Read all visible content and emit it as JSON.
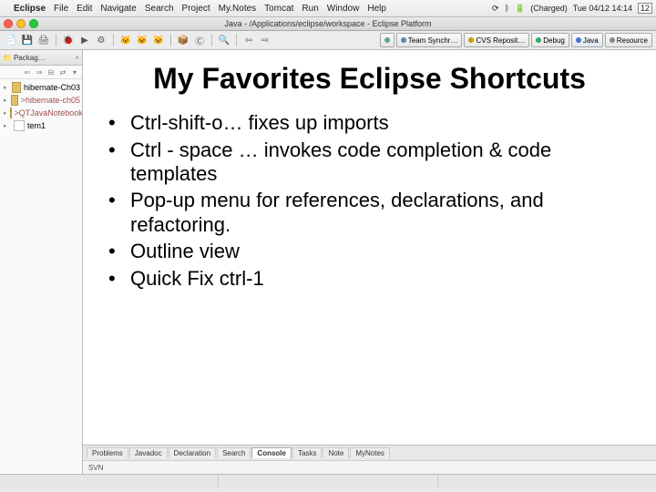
{
  "mac_menu": {
    "app_name": "Eclipse",
    "items": [
      "File",
      "Edit",
      "Navigate",
      "Search",
      "Project",
      "My.Notes",
      "Tomcat",
      "Run",
      "Window",
      "Help"
    ],
    "charge_label": "(Charged)",
    "clock": "Tue 04/12 14:14",
    "day_num": "12"
  },
  "window_title": "Java - /Applications/eclipse/workspace - Eclipse Platform",
  "perspectives": [
    "Team Synchr…",
    "CVS Reposit…",
    "Debug",
    "Java",
    "Resource"
  ],
  "package_explorer": {
    "title": "Packag…",
    "items": [
      {
        "label": "hibernate-Ch03",
        "icon": "folder",
        "dirty": false
      },
      {
        "label": ">hibernate-ch05",
        "icon": "folder",
        "dirty": true
      },
      {
        "label": ">QTJavaNotebook",
        "icon": "folder",
        "dirty": true
      },
      {
        "label": "tem1",
        "icon": "file",
        "dirty": false
      }
    ]
  },
  "slide": {
    "title": "My Favorites Eclipse Shortcuts",
    "bullets": [
      "Ctrl-shift-o… fixes up imports",
      "Ctrl - space … invokes code completion & code templates",
      "Pop-up menu for references, declarations, and refactoring.",
      "Outline view",
      "Quick Fix ctrl-1"
    ]
  },
  "bottom_tabs": [
    "Problems",
    "Javadoc",
    "Declaration",
    "Search",
    "Console",
    "Tasks",
    "Note",
    "MyNotes"
  ],
  "bottom_active_index": 4,
  "svn_label": "SVN"
}
